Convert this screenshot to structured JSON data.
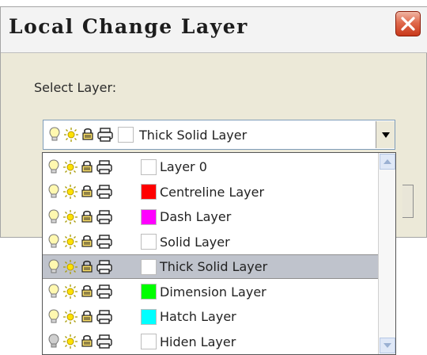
{
  "window": {
    "title": "Local Change Layer"
  },
  "dialog": {
    "select_label": "Select Layer:"
  },
  "combo": {
    "selected_value": "Thick Solid Layer",
    "selected_swatch": "#ffffff"
  },
  "dropdown": {
    "items": [
      {
        "label": "Layer 0",
        "color": "#ffffff",
        "bulb": "bulb-icon",
        "selected": false
      },
      {
        "label": "Centreline Layer",
        "color": "#ff0000",
        "bulb": "bulb-icon",
        "selected": false
      },
      {
        "label": "Dash Layer",
        "color": "#ff00ff",
        "bulb": "bulb-icon",
        "selected": false
      },
      {
        "label": "Solid Layer",
        "color": "#ffffff",
        "bulb": "bulb-icon",
        "selected": false
      },
      {
        "label": "Thick Solid Layer",
        "color": "#ffffff",
        "bulb": "bulb-icon",
        "selected": true
      },
      {
        "label": "Dimension Layer",
        "color": "#00ff00",
        "bulb": "bulb-icon",
        "selected": false
      },
      {
        "label": "Hatch Layer",
        "color": "#00ffff",
        "bulb": "bulb-icon",
        "selected": false
      },
      {
        "label": "Hiden Layer",
        "color": "#ffffff",
        "bulb": "bulb-icon-off",
        "selected": false
      }
    ]
  },
  "colors": {
    "dialog_bg": "#ece9d8",
    "close_button": "#c8381a",
    "selection": "#bfc3cc",
    "border": "#7f9db9"
  }
}
